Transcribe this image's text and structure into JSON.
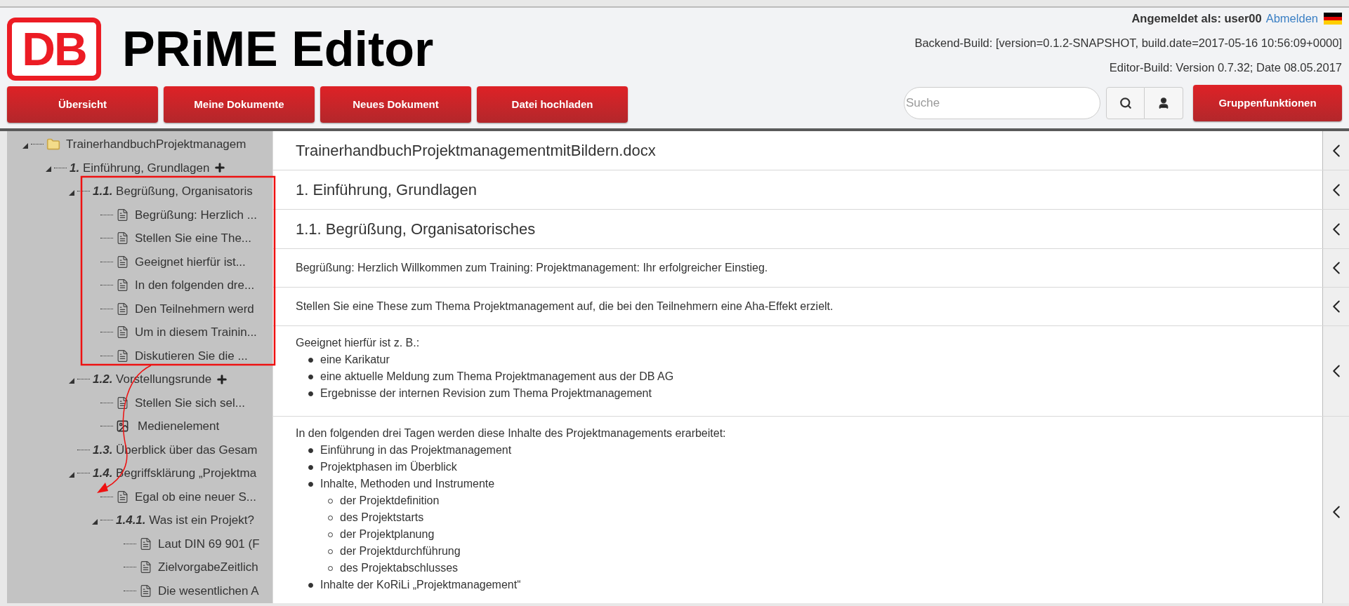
{
  "header": {
    "logo": "DB",
    "title": "PRiME Editor",
    "login_label": "Angemeldet als: user00",
    "logout_link": "Abmelden",
    "backend_build": "Backend-Build: [version=0.1.2-SNAPSHOT, build.date=2017-05-16 10:56:09+0000]",
    "editor_build": "Editor-Build: Version 0.7.32; Date 08.05.2017"
  },
  "nav": [
    {
      "label": "Übersicht"
    },
    {
      "label": "Meine Dokumente"
    },
    {
      "label": "Neues Dokument"
    },
    {
      "label": "Datei hochladen"
    }
  ],
  "search": {
    "placeholder": "Suche"
  },
  "group_button": "Gruppenfunktionen",
  "tree": [
    {
      "kind": "document",
      "label": "TrainerhandbuchProjektmanagem",
      "expanded": true,
      "children": [
        {
          "kind": "section",
          "number": "1.",
          "label": "Einführung, Grundlagen",
          "expanded": true,
          "addable": true,
          "children": [
            {
              "kind": "section",
              "number": "1.1.",
              "label": "Begrüßung, Organisatoris",
              "expanded": true,
              "addable": false,
              "children": [
                {
                  "kind": "text",
                  "label": "Begrüßung: Herzlich ..."
                },
                {
                  "kind": "text",
                  "label": "Stellen Sie eine The..."
                },
                {
                  "kind": "text",
                  "label": "Geeignet hierfür ist..."
                },
                {
                  "kind": "text",
                  "label": "In den folgenden dre..."
                },
                {
                  "kind": "text",
                  "label": "Den Teilnehmern werd"
                },
                {
                  "kind": "text",
                  "label": "Um in diesem Trainin..."
                },
                {
                  "kind": "text",
                  "label": "Diskutieren Sie die ..."
                }
              ]
            },
            {
              "kind": "section",
              "number": "1.2.",
              "label": "Vorstellungsrunde",
              "expanded": true,
              "addable": true,
              "children": [
                {
                  "kind": "text",
                  "label": "Stellen Sie sich sel..."
                },
                {
                  "kind": "media",
                  "label": "Medienelement"
                }
              ]
            },
            {
              "kind": "section",
              "number": "1.3.",
              "label": "Überblick über das Gesam",
              "expanded": false,
              "addable": false
            },
            {
              "kind": "section",
              "number": "1.4.",
              "label": "Begriffsklärung „Projektma",
              "expanded": true,
              "addable": false,
              "children": [
                {
                  "kind": "text",
                  "label": "Egal ob eine neuer S..."
                },
                {
                  "kind": "section",
                  "number": "1.4.1.",
                  "label": "Was ist ein Projekt?",
                  "expanded": true,
                  "addable": false,
                  "children": [
                    {
                      "kind": "text",
                      "label": "Laut DIN 69 901 (F"
                    },
                    {
                      "kind": "text",
                      "label": "ZielvorgabeZeitlich"
                    },
                    {
                      "kind": "text",
                      "label": "Die wesentlichen A"
                    }
                  ]
                }
              ]
            }
          ]
        }
      ]
    }
  ],
  "blocks": [
    {
      "kind": "title",
      "text": "TrainerhandbuchProjektmanagementmitBildern.docx"
    },
    {
      "kind": "heading",
      "text": "1. Einführung, Grundlagen"
    },
    {
      "kind": "heading",
      "text": "1.1. Begrüßung, Organisatorisches"
    },
    {
      "kind": "paragraph",
      "text": "Begrüßung: Herzlich Willkommen zum Training: Projektmanagement: Ihr erfolgreicher Einstieg."
    },
    {
      "kind": "paragraph",
      "text": "Stellen Sie eine These zum Thema Projektmanagement auf, die bei den Teilnehmern eine Aha-Effekt erzielt."
    },
    {
      "kind": "list",
      "text": "Geeignet hierfür ist z. B.:",
      "items": [
        {
          "text": "eine Karikatur"
        },
        {
          "text": "eine aktuelle Meldung zum Thema Projektmanagement aus der DB AG"
        },
        {
          "text": "Ergebnisse der internen Revision zum Thema Projektmanagement"
        }
      ]
    },
    {
      "kind": "list",
      "text": "In den folgenden drei Tagen werden diese Inhalte des Projektmanagements erarbeitet:",
      "items": [
        {
          "text": "Einführung in das Projektmanagement"
        },
        {
          "text": "Projektphasen im Überblick"
        },
        {
          "text": "Inhalte, Methoden und Instrumente",
          "children": [
            {
              "text": "der Projektdefinition"
            },
            {
              "text": "des Projektstarts"
            },
            {
              "text": "der Projektplanung"
            },
            {
              "text": "der Projektdurchführung"
            },
            {
              "text": "des Projektabschlusses"
            }
          ]
        },
        {
          "text": "Inhalte der KoRiLi „Projektmanagement“"
        }
      ]
    }
  ]
}
